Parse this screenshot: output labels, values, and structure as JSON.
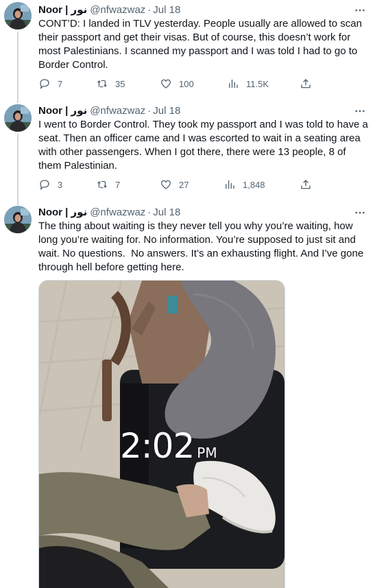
{
  "tweets": [
    {
      "name": "Noor | نور",
      "handle": "@nfwazwaz",
      "date": "Jul 18",
      "text": "CONT’D: I landed in TLV yesterday. People usually are allowed to scan their passport and get their visas. But of course, this doesn’t work for most Palestinians. I scanned my passport and I was told I had to go to Border Control.",
      "replies": "7",
      "retweets": "35",
      "likes": "100",
      "views": "11.5K"
    },
    {
      "name": "Noor | نور",
      "handle": "@nfwazwaz",
      "date": "Jul 18",
      "text": "I went to Border Control. They took my passport and I was told to have a seat. Then an officer came and I was escorted to wait in a seating area with other passengers. When I got there, there were 13 people, 8 of them Palestinian.",
      "replies": "3",
      "retweets": "7",
      "likes": "27",
      "views": "1,848"
    },
    {
      "name": "Noor | نور",
      "handle": "@nfwazwaz",
      "date": "Jul 18",
      "text": "The thing about waiting is they never tell you why you’re waiting, how long you’re waiting for. No information. You’re supposed to just sit and wait. No questions.  No answers. It’s an exhausting flight. And I’ve gone through hell before getting here.",
      "photo": {
        "clock_time": "2:02",
        "clock_ampm": "PM"
      }
    }
  ],
  "separator": "·",
  "icons": {
    "more": "more-dots-icon",
    "reply": "reply-bubble-icon",
    "retweet": "retweet-icon",
    "like": "heart-icon",
    "views": "views-chart-icon",
    "share": "share-upload-icon"
  },
  "colors": {
    "text": "#0f1419",
    "secondary": "#536471",
    "thread_line": "#cfd9de"
  }
}
